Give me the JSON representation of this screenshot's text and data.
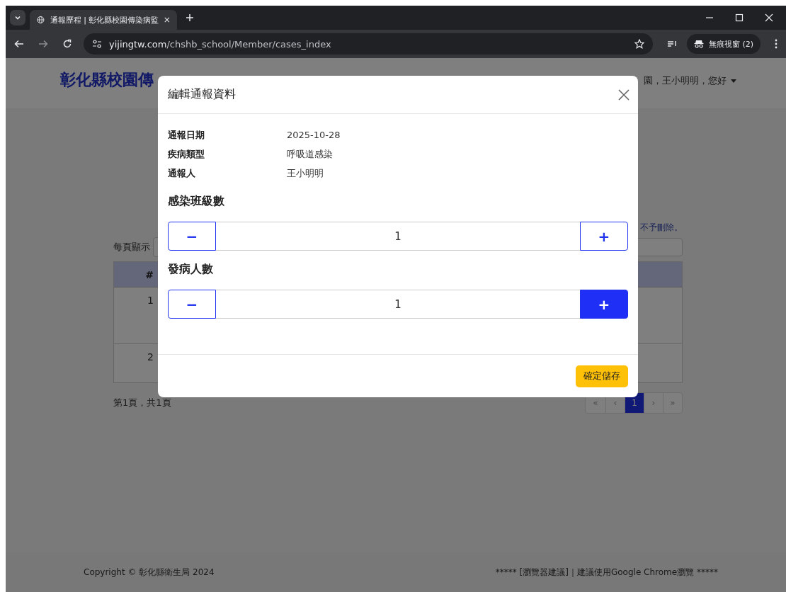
{
  "browser": {
    "tab_title": "通報歷程 | 彰化縣校園傳染病監",
    "url_host": "yijingtw.com",
    "url_path": "/chshb_school/Member/cases_index",
    "profile_label": "無痕視窗 (2)"
  },
  "page": {
    "site_title": "彰化縣校園傳",
    "user_greeting": "園，王小明明，您好",
    "notice_text": "不予刪除。",
    "per_page_label": "每頁顯示",
    "table": {
      "columns": [
        "#"
      ],
      "rows": [
        {
          "column_1": "1"
        },
        {
          "column_1": "2"
        }
      ]
    },
    "page_summary": "第1頁，共1頁",
    "pagination": [
      {
        "label": "«",
        "selected": false
      },
      {
        "label": "‹",
        "selected": false
      },
      {
        "label": "1",
        "selected": true
      },
      {
        "label": "›",
        "selected": false
      },
      {
        "label": "»",
        "selected": false
      }
    ],
    "footer": {
      "copyright": "Copyright © 彰化縣衛生局 2024",
      "browser_note": "***** [瀏覽器建議]｜建議使用Google Chrome瀏覽 *****"
    }
  },
  "modal": {
    "title": "編輯通報資料",
    "fields": [
      {
        "label": "通報日期",
        "value": "2025-10-28"
      },
      {
        "label": "疾病類型",
        "value": "呼吸道感染"
      },
      {
        "label": "通報人",
        "value": "王小明明"
      }
    ],
    "counters": [
      {
        "label": "感染班級數",
        "value": "1",
        "minus": "−",
        "plus": "+",
        "plus_highlighted": false
      },
      {
        "label": "發病人數",
        "value": "1",
        "minus": "−",
        "plus": "+",
        "plus_highlighted": true
      }
    ],
    "save_button": "確定儲存"
  }
}
